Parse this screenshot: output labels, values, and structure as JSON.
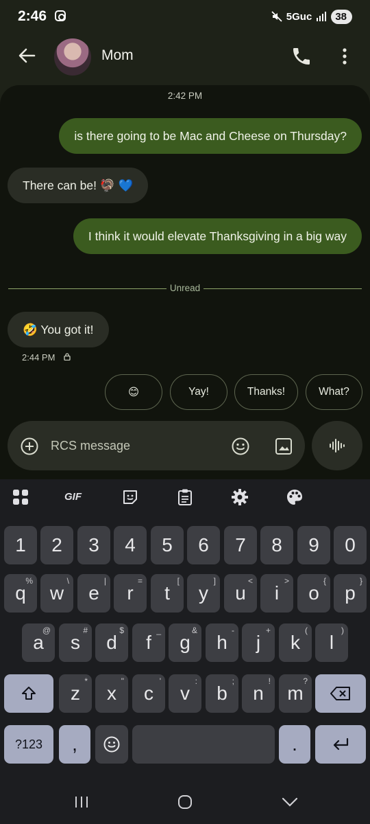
{
  "status": {
    "time": "2:46",
    "network": "5Guc",
    "battery": "38"
  },
  "header": {
    "contact_name": "Mom"
  },
  "chat": {
    "timestamp_top": "2:42 PM",
    "messages": [
      {
        "dir": "out",
        "text": "is there going to be Mac and Cheese on Thursday?"
      },
      {
        "dir": "in",
        "text": "There can be! 🦃 💙"
      },
      {
        "dir": "out",
        "text": "I think it would elevate Thanksgiving in a big way"
      },
      {
        "dir": "in",
        "text": "🤣 You got it!"
      }
    ],
    "unread_label": "Unread",
    "timestamp_bottom": "2:44 PM"
  },
  "smart_replies": [
    "😊",
    "Yay!",
    "Thanks!",
    "What?"
  ],
  "compose": {
    "placeholder": "RCS message"
  },
  "keyboard": {
    "gif_label": "GIF",
    "row_numbers": [
      "1",
      "2",
      "3",
      "4",
      "5",
      "6",
      "7",
      "8",
      "9",
      "0"
    ],
    "row_qwerty": [
      [
        "q",
        "%"
      ],
      [
        "w",
        "\\"
      ],
      [
        "e",
        "|"
      ],
      [
        "r",
        "="
      ],
      [
        "t",
        "["
      ],
      [
        "y",
        "]"
      ],
      [
        "u",
        "<"
      ],
      [
        "i",
        ">"
      ],
      [
        "o",
        "{"
      ],
      [
        "p",
        "}"
      ]
    ],
    "row_asdf": [
      [
        "a",
        "@"
      ],
      [
        "s",
        "#"
      ],
      [
        "d",
        "$"
      ],
      [
        "f",
        "_"
      ],
      [
        "g",
        "&"
      ],
      [
        "h",
        "-"
      ],
      [
        "j",
        "+"
      ],
      [
        "k",
        "("
      ],
      [
        "l",
        ")"
      ]
    ],
    "row_zxcv": [
      [
        "z",
        "*"
      ],
      [
        "x",
        "\""
      ],
      [
        "c",
        "'"
      ],
      [
        "v",
        ":"
      ],
      [
        "b",
        ";"
      ],
      [
        "n",
        "!"
      ],
      [
        "m",
        "?"
      ]
    ],
    "symbols_label": "?123",
    "comma": ",",
    "period": "."
  },
  "colors": {
    "outgoing_bubble": "#3b5b1f",
    "incoming_bubble": "#2a2d25",
    "chat_bg": "#11140d",
    "keyboard_bg": "#1c1d20"
  }
}
